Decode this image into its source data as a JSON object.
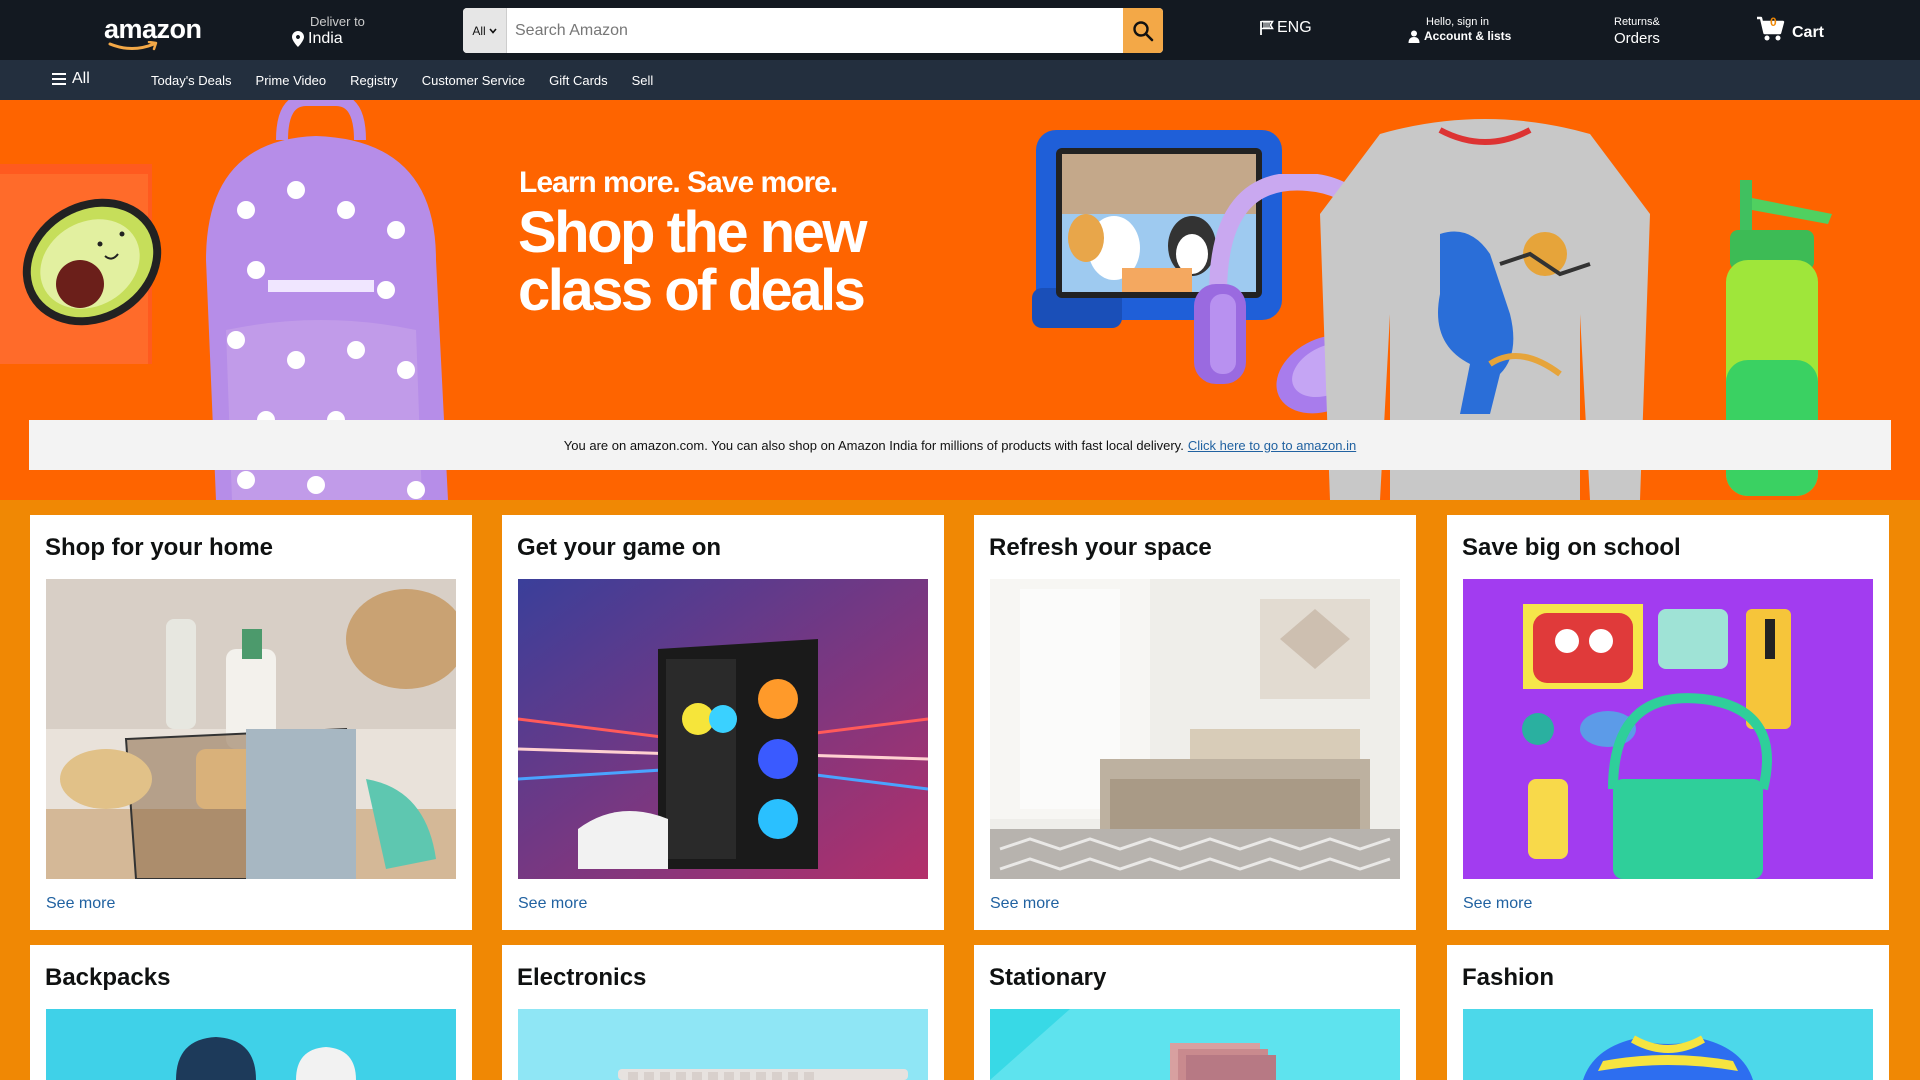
{
  "header": {
    "logo": "amazon",
    "deliver_label": "Deliver to",
    "deliver_location": "India",
    "search_category": "All",
    "search_placeholder": "Search Amazon",
    "language": "ENG",
    "account_greeting": "Hello, sign in",
    "account_label": "Account & lists",
    "returns_label": "Returns&",
    "orders_label": "Orders",
    "cart_count": "0",
    "cart_label": "Cart"
  },
  "subnav": {
    "all_label": "All",
    "links": [
      "Today's Deals",
      "Prime Video",
      "Registry",
      "Customer Service",
      "Gift Cards",
      "Sell"
    ]
  },
  "hero": {
    "headline1": "Learn more. Save more.",
    "headline2_line1": "Shop the new",
    "headline2_line2": "class of deals"
  },
  "notice": {
    "text": "You are on amazon.com. You can also shop on Amazon India for millions of products with fast local delivery.",
    "link": "Click here to go to amazon.in"
  },
  "cards": [
    {
      "title": "Shop for your home",
      "link": "See more"
    },
    {
      "title": "Get your game on",
      "link": "See more"
    },
    {
      "title": "Refresh your space",
      "link": "See more"
    },
    {
      "title": "Save big on school",
      "link": "See more"
    },
    {
      "title": "Backpacks"
    },
    {
      "title": "Electronics"
    },
    {
      "title": "Stationary"
    },
    {
      "title": "Fashion"
    }
  ],
  "colors": {
    "topnav_bg": "#131921",
    "subnav_bg": "#232f3e",
    "hero_bg": "#fe6400",
    "page_bg": "#f08804",
    "link": "#2162a1",
    "search_button": "#f3a847"
  },
  "icons": [
    "location-pin-icon",
    "search-icon",
    "flag-icon",
    "person-icon",
    "cart-icon",
    "hamburger-icon",
    "chevron-down-icon"
  ]
}
